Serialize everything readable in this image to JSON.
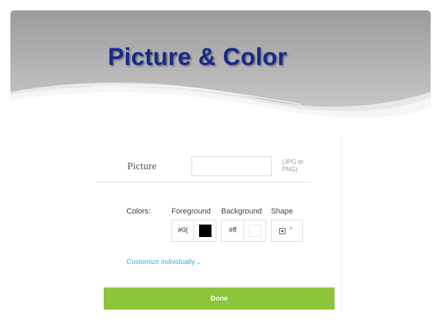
{
  "slide": {
    "title": "Picture & Color"
  },
  "dialog": {
    "picture": {
      "label": "Picture",
      "value": "",
      "hint": "(JPG or PNG)"
    },
    "colors": {
      "label": "Colors:",
      "foreground": {
        "title": "Foreground",
        "hex": "#0(",
        "color": "#000000"
      },
      "background": {
        "title": "Background",
        "hex": "#ff",
        "color": "#ffffff"
      },
      "shape": {
        "title": "Shape",
        "icon": "square-dot-icon"
      }
    },
    "customize_link": "Customize individually",
    "done_label": "Done"
  },
  "theme": {
    "title_color": "#152a8a",
    "link_color": "#3ca6d6",
    "button_color": "#8cc43a"
  }
}
